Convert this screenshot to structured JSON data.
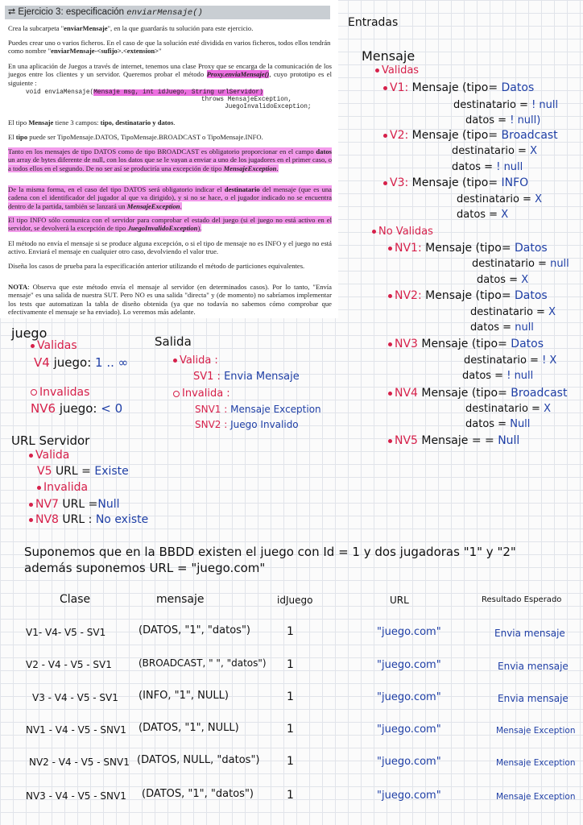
{
  "pdf": {
    "title_prefix": "Ejercicio 3: especificación ",
    "title_method": "enviarMensaje()",
    "p1": {
      "a": "Crea la subcarpeta \"",
      "b": "enviarMensaje",
      "c": "\", en la que guardarás tu solución para este ejercicio."
    },
    "p2": {
      "a": "Puedes crear uno o varios ficheros. En el caso de que la solución esté dividida en varios ficheros, todos ellos tendrán como nombre \"",
      "b": "enviarMensaje-<sufijo>.<extension>",
      "c": ""
    },
    "p3": {
      "a": "En una aplicación de Juegos a través de internet, tenemos una clase Proxy que se encarga de la comunicación de los juegos entre los clientes y un servidor. Queremos probar el método ",
      "b": "Proxy.enviaMensaje()",
      "c": ", cuyo prototipo es el siguiente :"
    },
    "code1": "void enviaMensaje(",
    "code_params": "Mensaje msg, int idJuego, String urlServidor)",
    "code2": "throws MensajeException,",
    "code3": "JuegoInvalidoException;",
    "p4": {
      "a": "El tipo ",
      "b": "Mensaje",
      "c": " tiene 3 campos: ",
      "d": "tipo, destinatario y datos",
      "e": "."
    },
    "p5": {
      "a": "El ",
      "b": "tipo",
      "c": " puede ser TipoMensaje.DATOS, TipoMensaje.BROADCAST o TipoMensaje.INFO."
    },
    "p6": {
      "a": "Tanto en los mensajes de tipo DATOS como de tipo BROADCAST es obligatorio proporcionar en el campo ",
      "b": "datos",
      "c": " un array de bytes diferente de null, con los datos que se le vayan a enviar a uno de los jugadores en el primer caso, o a todos ellos en el segundo. De no ser así se produciría una excepción de tipo ",
      "d": "MensajeException",
      "e": "."
    },
    "p7": {
      "a": "De la misma forma, en el caso del tipo DATOS será obligatorio indicar el ",
      "b": "destinatario",
      "c": " del mensaje (que es una cadena con el identificador del jugador al que va dirigido), y si no se hace, o el jugador indicado no se encuentra dentro de la partida, también se lanzará un ",
      "d": "MensajeException",
      "e": "."
    },
    "p8": {
      "a": "El tipo INFO sólo comunica con el servidor para comprobar el estado del juego (si el juego no está activo en el servidor, se devolverá la excepción de tipo ",
      "b": "JuegoInvalidoException",
      "c": ")."
    },
    "p9": "El método no envía el mensaje si se produce alguna excepción, o si el tipo de mensaje no es INFO y el juego no está activo. Enviará el mensaje en cualquier otro caso, devolviendo el valor true.",
    "p10": "Diseña los casos de prueba para la especificación anterior utilizando el método de particiones equivalentes.",
    "p11": {
      "a": "NOTA",
      "b": ": Observa que este método envía el mensaje al servidor (en determinados casos). Por lo tanto, \"Envía mensaje\" es una salida de nuestra SUT. Pero NO es una salida \"directa\" y (de momento) no sabríamos implementar los tests que automatizan la tabla de diseño obtenida (ya que no todavía no sabemos cómo comprobar que efectivamente el mensaje se ha enviado). Lo veremos más adelante."
    }
  },
  "notes": {
    "entradas": "Entradas",
    "mensaje": "Mensaje",
    "validas": "Validas",
    "v1": {
      "label": "V1:",
      "a": "Mensaje (tipo=",
      "tipo": "Datos",
      "dest_l": "destinatario =",
      "dest": "! null",
      "datos_l": "datos =",
      "datos": "! null)"
    },
    "v2": {
      "label": "V2:",
      "a": "Mensaje (tipo=",
      "tipo": "Broadcast",
      "dest_l": "destinatario =",
      "dest": "X",
      "datos_l": "datos =",
      "datos": "! null"
    },
    "v3": {
      "label": "V3:",
      "a": "Mensaje (tipo=",
      "tipo": "INFO",
      "dest_l": "destinatario =",
      "dest": "X",
      "datos_l": "datos =",
      "datos": "X"
    },
    "no_validas": "No Validas",
    "nv1": {
      "label": "NV1:",
      "a": "Mensaje (tipo=",
      "tipo": "Datos",
      "dest_l": "destinatario =",
      "dest": "null",
      "datos_l": "datos =",
      "datos": "X"
    },
    "nv2": {
      "label": "NV2:",
      "a": "Mensaje (tipo=",
      "tipo": "Datos",
      "dest_l": "destinatario =",
      "dest": "X",
      "datos_l": "datos =",
      "datos": "null"
    },
    "nv3": {
      "label": "NV3",
      "a": "Mensaje (tipo=",
      "tipo": "Datos",
      "dest_l": "destinatario =",
      "dest": "! X",
      "datos_l": "datos =",
      "datos": "! null"
    },
    "nv4": {
      "label": "NV4",
      "a": "Mensaje (tipo=",
      "tipo": "Broadcast",
      "dest_l": "destinatario =",
      "dest": "X",
      "datos_l": "datos =",
      "datos": "Null"
    },
    "nv5": {
      "label": "NV5",
      "a": "Mensaje = =",
      "b": "Null"
    },
    "juego": "juego",
    "j_validas": "Validas",
    "v4": {
      "label": "V4",
      "a": "juego:",
      "b": "1 .. ∞"
    },
    "j_invalidas": "Invalidas",
    "nv6": {
      "label": "NV6",
      "a": "juego:",
      "b": "< 0"
    },
    "salida": "Salida",
    "s_valida": "Valida :",
    "sv1": {
      "label": "SV1 :",
      "b": "Envia Mensaje"
    },
    "s_invalida": "Invalida :",
    "snv1": {
      "label": "SNV1 :",
      "b": "Mensaje Exception"
    },
    "snv2": {
      "label": "SNV2 :",
      "b": "Juego Invalido"
    },
    "url": "URL Servidor",
    "u_valida": "Valida",
    "v5": {
      "label": "V5",
      "a": "URL =",
      "b": "Existe"
    },
    "u_invalida": "Invalida",
    "nv7": {
      "label": "NV7",
      "a": "URL =",
      "b": "Null"
    },
    "nv8": {
      "label": "NV8",
      "a": "URL :",
      "b": "No existe"
    },
    "sup1": "Suponemos que en la BBDD existen el juego con Id = 1 y dos jugadoras \"1\" y \"2\"",
    "sup2": "además suponemos URL = \"juego.com\""
  },
  "table": {
    "headers": [
      "Clase",
      "mensaje",
      "idJuego",
      "URL",
      "Resultado Esperado"
    ],
    "rows": [
      [
        "V1- V4- V5 - SV1",
        "(DATOS, \"1\", \"datos\")",
        "1",
        "\"juego.com\"",
        "Envia mensaje"
      ],
      [
        "V2 - V4 - V5 - SV1",
        "(BROADCAST, \" \", \"datos\")",
        "1",
        "\"juego.com\"",
        "Envia mensaje"
      ],
      [
        "V3 - V4 - V5 - SV1",
        "(INFO, \"1\", NULL)",
        "1",
        "\"juego.com\"",
        "Envia mensaje"
      ],
      [
        "NV1 - V4 - V5 - SNV1",
        "(DATOS, \"1\", NULL)",
        "1",
        "\"juego.com\"",
        "Mensaje Exception"
      ],
      [
        "NV2 - V4 - V5 - SNV1",
        "(DATOS, NULL, \"datos\")",
        "1",
        "\"juego.com\"",
        "Mensaje Exception"
      ],
      [
        "NV3 - V4 - V5 - SNV1",
        "(DATOS, \"1\", \"datos\")",
        "1",
        "\"juego.com\"",
        "Mensaje Exception"
      ]
    ]
  }
}
